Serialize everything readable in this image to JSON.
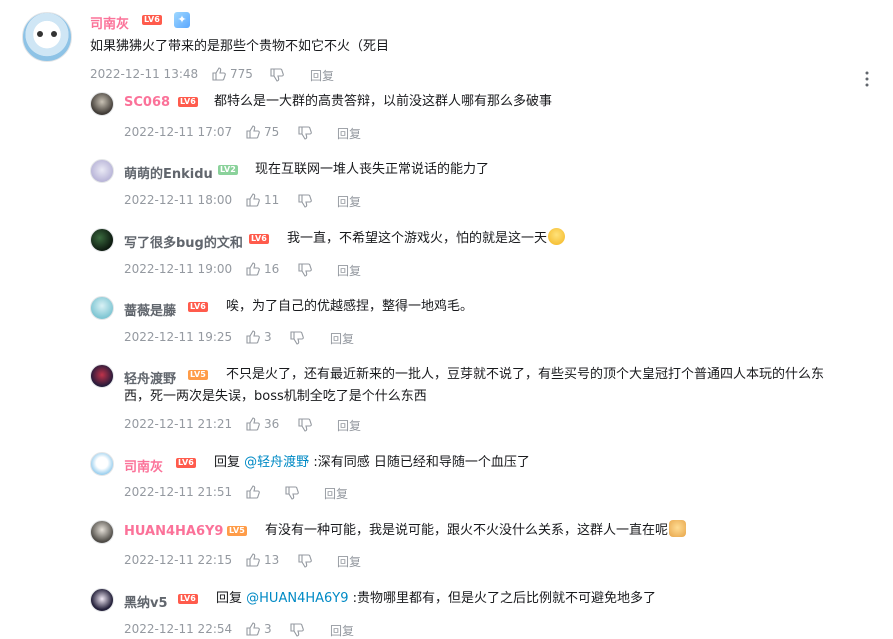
{
  "main": {
    "username": "司南灰",
    "level": "LV6",
    "text": "如果狒狒火了带来的是那些个贵物不如它不火（死目",
    "time": "2022-12-11 13:48",
    "likes": "775",
    "reply_label": "回复"
  },
  "replies": [
    {
      "username": "SC068",
      "level": "LV6",
      "text": "都特么是一大群的高贵答辩，以前没这群人哪有那么多破事",
      "time": "2022-12-11 17:07",
      "likes": "75",
      "reply_label": "回复"
    },
    {
      "username": "萌萌的Enkidu",
      "level": "LV2",
      "text": "现在互联网一堆人丧失正常说话的能力了",
      "time": "2022-12-11 18:00",
      "likes": "11",
      "reply_label": "回复"
    },
    {
      "username": "写了很多bug的文和",
      "level": "LV6",
      "text": "我一直，不希望这个游戏火，怕的就是这一天",
      "time": "2022-12-11 19:00",
      "likes": "16",
      "reply_label": "回复"
    },
    {
      "username": "蔷薇是藤",
      "level": "LV6",
      "text": "唉，为了自己的优越感捏，整得一地鸡毛。",
      "time": "2022-12-11 19:25",
      "likes": "3",
      "reply_label": "回复"
    },
    {
      "username": "轻舟渡野",
      "level": "LV5",
      "text_line1": "不只是火了，还有最近新来的一批人，豆芽就不说了，有些买号的顶个大皇冠打个普通四人本玩的什么东",
      "text_line2": "西，死一两次是失误，boss机制全吃了是个什么东西",
      "time": "2022-12-11 21:21",
      "likes": "36",
      "reply_label": "回复"
    },
    {
      "username": "司南灰",
      "level": "LV6",
      "reply_prefix": "回复",
      "mention": "@轻舟渡野",
      "text": ":深有同感 日随已经和导随一个血压了",
      "time": "2022-12-11 21:51",
      "likes": "",
      "reply_label": "回复"
    },
    {
      "username": "HUAN4HA6Y9",
      "level": "LV5",
      "text": "有没有一种可能，我是说可能，跟火不火没什么关系，这群人一直在呢",
      "time": "2022-12-11 22:15",
      "likes": "13",
      "reply_label": "回复"
    },
    {
      "username": "黑纳v5",
      "level": "LV6",
      "reply_prefix": "回复",
      "mention": "@HUAN4HA6Y9",
      "text": ":贵物哪里都有，但是火了之后比例就不可避免地多了",
      "time": "2022-12-11 22:54",
      "likes": "3",
      "reply_label": "回复"
    }
  ]
}
